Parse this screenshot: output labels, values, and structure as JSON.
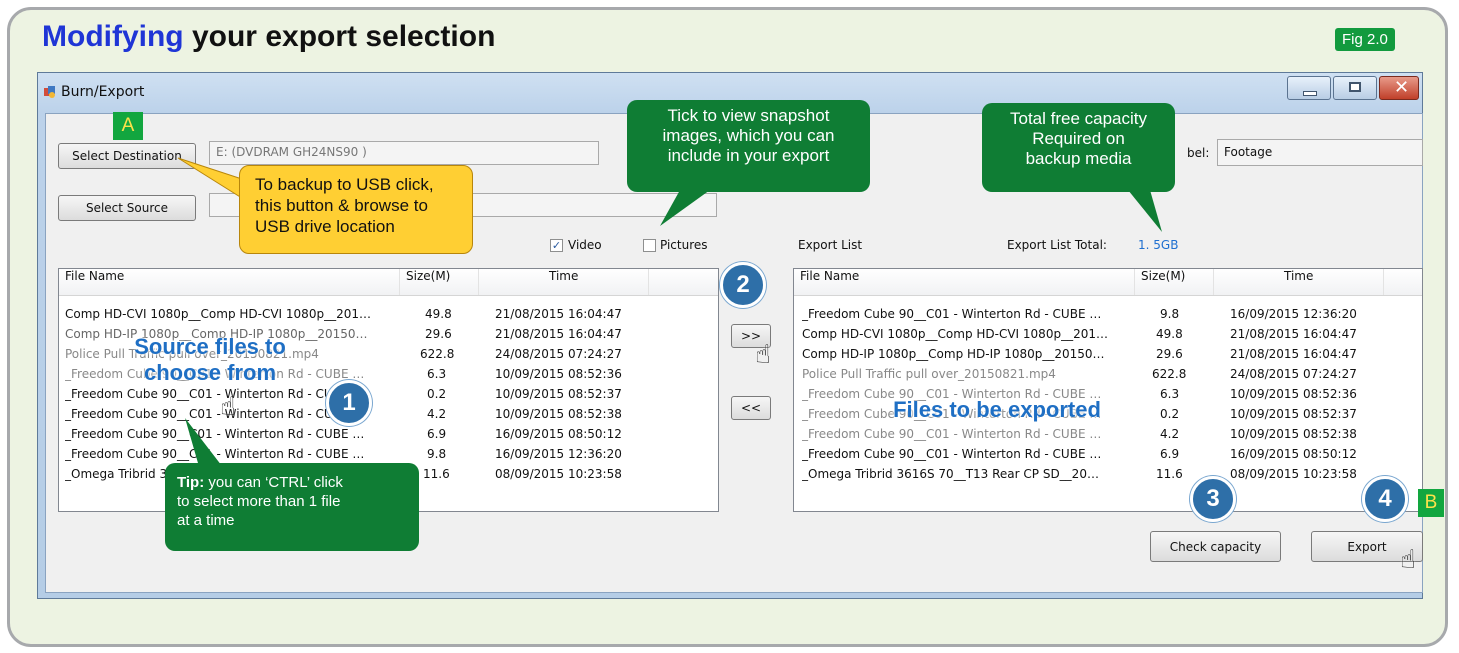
{
  "header": {
    "title_highlight": "Modifying",
    "title_rest": " your export selection",
    "fig_label": "Fig 2.0"
  },
  "window": {
    "title": "Burn/Export"
  },
  "form": {
    "select_destination": "Select Destination",
    "destination_value": "E: (DVDRAM GH24NS90 )",
    "select_source": "Select Source",
    "source_value": "",
    "label_caption": "bel:",
    "label_value": "Footage",
    "video_label": "Video",
    "video_checked": true,
    "pictures_label": "Pictures",
    "pictures_checked": false,
    "export_list_label": "Export List",
    "export_total_label": "Export List Total:",
    "export_total_value": "1. 5GB"
  },
  "source_list": {
    "columns": [
      "File Name",
      "Size(M)",
      "Time"
    ],
    "rows": [
      {
        "name": "Comp HD-CVI 1080p__Comp HD-CVI 1080p__201…",
        "size": "49.8",
        "time": "21/08/2015 16:04:47"
      },
      {
        "name": "Comp HD-IP 1080p__Comp HD-IP 1080p__20150…",
        "size": "29.6",
        "time": "21/08/2015 16:04:47"
      },
      {
        "name": "Police Pull Traffic pull over_20150821.mp4",
        "size": "622.8",
        "time": "24/08/2015 07:24:27"
      },
      {
        "name": "_Freedom Cube 90__C01 - Winterton Rd - CUBE …",
        "size": "6.3",
        "time": "10/09/2015 08:52:36"
      },
      {
        "name": "_Freedom Cube 90__C01 - Winterton Rd - CUBE …",
        "size": "0.2",
        "time": "10/09/2015 08:52:37"
      },
      {
        "name": "_Freedom Cube 90__C01 - Winterton Rd - CUBE …",
        "size": "4.2",
        "time": "10/09/2015 08:52:38"
      },
      {
        "name": "_Freedom Cube 90__C01 - Winterton Rd - CUBE …",
        "size": "6.9",
        "time": "16/09/2015 08:50:12"
      },
      {
        "name": "_Freedom Cube 90__C01 - Winterton Rd - CUBE …",
        "size": "9.8",
        "time": "16/09/2015 12:36:20"
      },
      {
        "name": "_Omega Tribrid 3616S 70__T13 Rear CP SD__20…",
        "size": "11.6",
        "time": "08/09/2015 10:23:58"
      }
    ]
  },
  "export_list": {
    "columns": [
      "File Name",
      "Size(M)",
      "Time"
    ],
    "rows": [
      {
        "name": "_Freedom Cube 90__C01 - Winterton Rd - CUBE …",
        "size": "9.8",
        "time": "16/09/2015 12:36:20"
      },
      {
        "name": "Comp HD-CVI 1080p__Comp HD-CVI 1080p__201…",
        "size": "49.8",
        "time": "21/08/2015 16:04:47"
      },
      {
        "name": "Comp HD-IP 1080p__Comp HD-IP 1080p__20150…",
        "size": "29.6",
        "time": "21/08/2015 16:04:47"
      },
      {
        "name": "Police Pull Traffic pull over_20150821.mp4",
        "size": "622.8",
        "time": "24/08/2015 07:24:27"
      },
      {
        "name": "_Freedom Cube 90__C01 - Winterton Rd - CUBE …",
        "size": "6.3",
        "time": "10/09/2015 08:52:36"
      },
      {
        "name": "_Freedom Cube 90__C01 - Winterton Rd - CUBE …",
        "size": "0.2",
        "time": "10/09/2015 08:52:37"
      },
      {
        "name": "_Freedom Cube 90__C01 - Winterton Rd - CUBE …",
        "size": "4.2",
        "time": "10/09/2015 08:52:38"
      },
      {
        "name": "_Freedom Cube 90__C01 - Winterton Rd - CUBE …",
        "size": "6.9",
        "time": "16/09/2015 08:50:12"
      },
      {
        "name": "_Omega Tribrid 3616S 70__T13 Rear CP SD__20…",
        "size": "11.6",
        "time": "08/09/2015 10:23:58"
      }
    ]
  },
  "buttons": {
    "add": ">>",
    "remove": "<<",
    "check_capacity": "Check capacity",
    "export": "Export"
  },
  "annotations": {
    "badge_a": "A",
    "badge_b": "B",
    "usb_callout_lines": [
      "To backup to USB click,",
      "this button & browse to",
      "USB drive location"
    ],
    "snapshot_callout_lines": [
      "Tick to view snapshot",
      "images, which you can",
      "include in your export"
    ],
    "capacity_callout_lines": [
      "Total free capacity",
      "Required on",
      "backup media"
    ],
    "tip_bold": "Tip:",
    "tip_lines": [
      " you can ‘CTRL’ click",
      "to select more than 1 file",
      "at a time"
    ],
    "source_overlay_lines": [
      "Source files to",
      "choose from"
    ],
    "export_overlay": "Files to be exported",
    "step1": "1",
    "step2": "2",
    "step3": "3",
    "step4": "4"
  },
  "colors": {
    "title_highlight": "#1f35d6",
    "callout_green": "#0f7d34",
    "callout_yellow": "#ffcf33",
    "step_blue": "#2e6fa8",
    "overlay_blue": "#1f6fc4"
  }
}
